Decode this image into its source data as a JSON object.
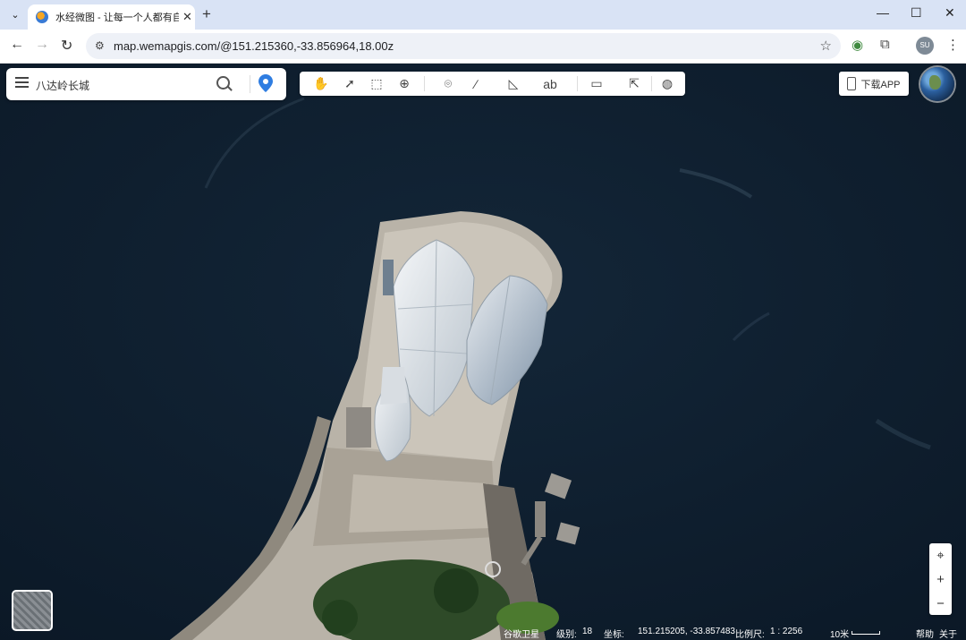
{
  "browser": {
    "tab_title": "水经微图 - 让每一个人都有自己",
    "tab_close": "✕",
    "new_tab": "+",
    "url": "map.wemapgis.com/@151.215360,-33.856964,18.00z",
    "window_controls": {
      "minimize": "—",
      "maximize": "☐",
      "close": "✕"
    },
    "avatar_label": "SU"
  },
  "search": {
    "value": "八达岭长城",
    "placeholder": ""
  },
  "toolbar": {
    "icons": [
      "pan-hand-icon",
      "select-arrow-icon",
      "box-select-icon",
      "zoom-area-icon",
      "place-marker-icon",
      "polyline-icon",
      "polygon-icon",
      "text-label-icon",
      "ruler-icon",
      "pointer-config-icon",
      "globe-grid-icon"
    ]
  },
  "download_button": {
    "label": "下载APP"
  },
  "zoom": {
    "locate": "⌖",
    "plus": "+",
    "minus": "−"
  },
  "status": {
    "source": "谷歌卫星",
    "level_label": "级别:",
    "level_value": "18",
    "coord_label": "坐标:",
    "coord_value": "151.215205, -33.857483",
    "scale_label": "比例尺:",
    "scale_value": "1 : 2256",
    "scale_bar": "10米",
    "help": "帮助",
    "about": "关于"
  }
}
